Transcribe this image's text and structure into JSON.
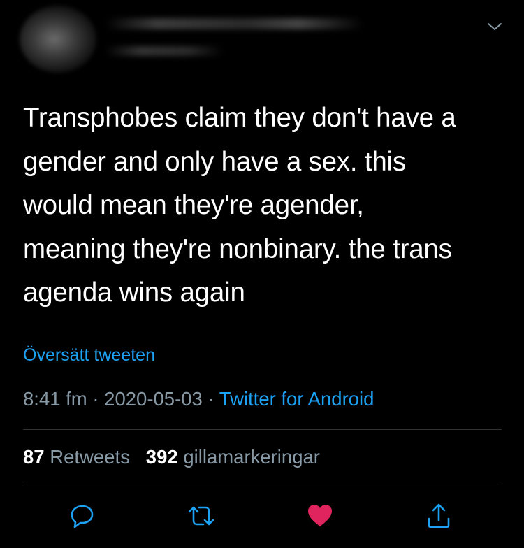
{
  "tweet": {
    "text": "Transphobes claim they don't have a\ngender and only have a sex. this\nwould mean they're agender,\nmeaning they're nonbinary. the trans\nagenda wins again",
    "translate_label": "Översätt tweeten",
    "time": "8:41 fm",
    "separator": " · ",
    "date": "2020-05-03",
    "source": "Twitter for Android"
  },
  "stats": {
    "retweets_count": "87",
    "retweets_label": "Retweets",
    "likes_count": "392",
    "likes_label": "gillamarkeringar"
  },
  "colors": {
    "background": "#000000",
    "link": "#1da1f2",
    "secondary_text": "#8899a6",
    "like": "#e0245e"
  },
  "icons": [
    "chevron-down-icon",
    "reply-icon",
    "retweet-icon",
    "like-icon",
    "share-icon"
  ]
}
